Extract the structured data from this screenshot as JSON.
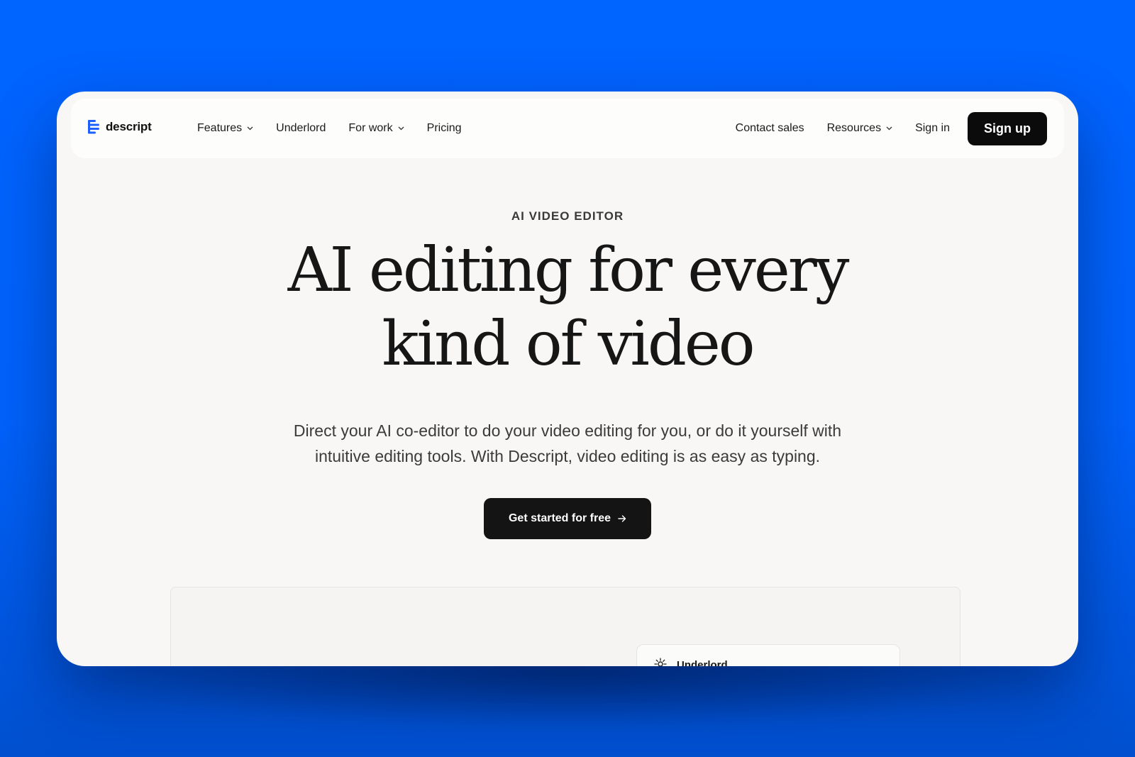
{
  "brand": {
    "name": "descript",
    "logo_color": "#1f5eff"
  },
  "nav": {
    "left": [
      {
        "label": "Features",
        "dropdown": true
      },
      {
        "label": "Underlord",
        "dropdown": false
      },
      {
        "label": "For work",
        "dropdown": true
      },
      {
        "label": "Pricing",
        "dropdown": false
      }
    ],
    "right": [
      {
        "label": "Contact sales",
        "dropdown": false
      },
      {
        "label": "Resources",
        "dropdown": true
      },
      {
        "label": "Sign in",
        "dropdown": false
      }
    ],
    "signup_label": "Sign up"
  },
  "hero": {
    "eyebrow": "AI VIDEO EDITOR",
    "headline_line1": "AI editing for every",
    "headline_line2": "kind of video",
    "subtext_line1": "Direct your AI co-editor to do your video editing for you, or do it yourself with",
    "subtext_line2": "intuitive editing tools. With Descript, video editing is as easy as typing.",
    "cta_label": "Get started for free",
    "cta_icon": "arrow-right-icon"
  },
  "preview": {
    "card_label": "Underlord",
    "card_icon": "underlord-sparkle-icon"
  },
  "colors": {
    "background": "#0064ff",
    "page": "#f8f7f6",
    "primary_button": "#0b0b0b",
    "text": "#161616"
  }
}
